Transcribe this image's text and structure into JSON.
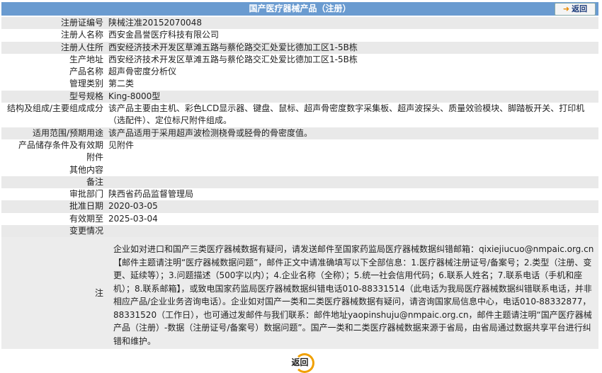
{
  "header": {
    "title": "国产医疗器械产品（注册）",
    "back_label": "返回"
  },
  "rows": [
    {
      "label": "注册证编号",
      "value": "陕械注准20152070048",
      "shade": true
    },
    {
      "label": "注册人名称",
      "value": "西安金昌誉医疗科技有限公司",
      "shade": false
    },
    {
      "label": "注册人住所",
      "value": "西安经济技术开发区草滩五路与蔡伦路交汇处爱比德加工区1-5B栋",
      "shade": true
    },
    {
      "label": "生产地址",
      "value": "西安经济技术开发区草滩五路与蔡伦路交汇处爱比德加工区1-5B栋",
      "shade": false
    },
    {
      "label": "产品名称",
      "value": "超声骨密度分析仪",
      "shade": false
    },
    {
      "label": "管理类别",
      "value": "第二类",
      "shade": false
    },
    {
      "label": "型号规格",
      "value": "King-8000型",
      "shade": true
    },
    {
      "label": "结构及组成/主要组成成分",
      "value": "该产品主要由主机、彩色LCD显示器、键盘、鼠标、超声骨密度数字采集板、超声波探头、质量效验模块、脚踏板开关、打印机（选配件）、定位标尺附件组成。",
      "shade": false
    },
    {
      "label": "适用范围/预期用途",
      "value": "该产品适用于采用超声波检测桡骨或胫骨的骨密度值。",
      "shade": true
    },
    {
      "label": "产品储存条件及有效期",
      "value": "见附件",
      "shade": false
    },
    {
      "label": "附件",
      "value": "",
      "shade": false
    },
    {
      "label": "其他内容",
      "value": "",
      "shade": false
    },
    {
      "label": "备注",
      "value": "",
      "shade": true
    },
    {
      "label": "审批部门",
      "value": "陕西省药品监督管理局",
      "shade": false
    },
    {
      "label": "批准日期",
      "value": "2020-03-05",
      "shade": true
    },
    {
      "label": "有效期至",
      "value": "2025-03-04",
      "shade": false
    },
    {
      "label": "变更情况",
      "value": "",
      "shade": true
    }
  ],
  "note": {
    "label": "注",
    "text": "企业如对进口和国产三类医疗器械数据有疑问，请发送邮件至国家药监局医疗器械数据纠错邮箱：qixiejiucuo@nmpaic.org.cn【邮件主题请注明“医疗器械数据问题”，邮件正文中请准确填写以下全部信息：1.医疗器械注册证号/备案号；2.类型（注册、变更、延续等）；3.问题描述（500字以内）；4.企业名称（全称）；5.统一社会信用代码；6.联系人姓名；7.联系电话（手机和座机）；8.联系邮箱】，或致电国家药监局医疗器械数据纠错电话010-88331514（此电话为我局医疗器械数据纠错联系电话，并非相应产品/企业业务咨询电话）。企业如对国产一类和二类医疗器械数据有疑问，请咨询国家局信息中心，电话010-88332877，88331520（工作日），也可通过发邮件与我们联系：邮件地址yaopinshuju@nmpaic.org.cn，邮件主题请注明“国产医疗器械产品（注册）-数据（注册证号/备案号）数据问题”。国产一类和二类医疗器械数据来源于省局，由省局通过数据共享平台进行纠错和维护。"
  },
  "footer": {
    "back_label": "返回"
  },
  "colors": {
    "header": "#6a9bd0",
    "row_shade": "#e9e9e9",
    "accent": "#f0a000"
  },
  "icons": {
    "back_top": "arrow-right-icon",
    "back_bottom": "ring-icon"
  }
}
